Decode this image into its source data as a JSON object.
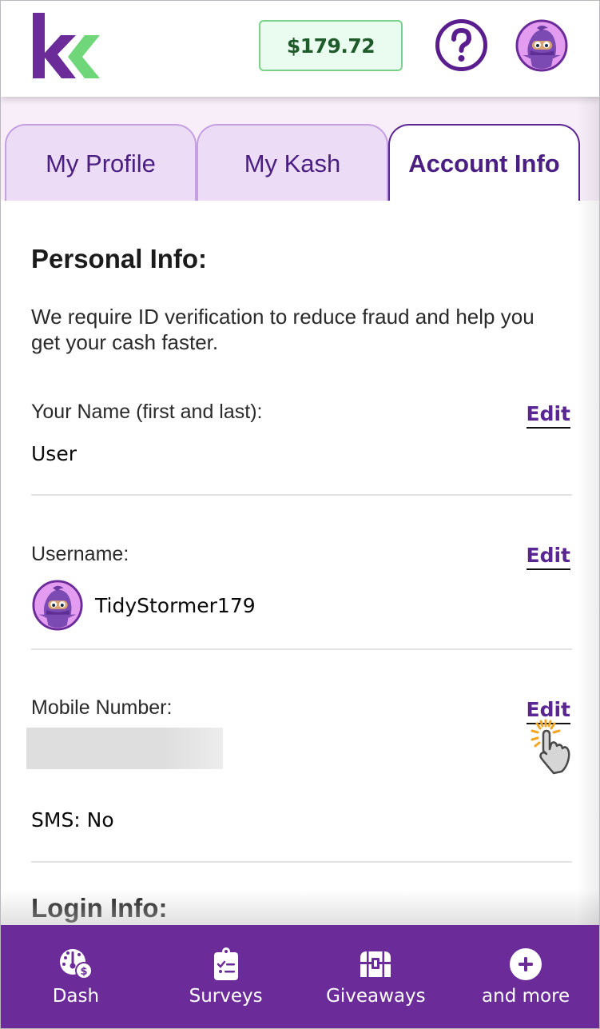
{
  "header": {
    "logo_alt": "Kashkick logo",
    "balance": "$179.72",
    "help_icon": "question-circle-icon",
    "avatar_icon": "ninja-avatar-icon"
  },
  "tabs": [
    {
      "label": "My Profile",
      "active": false
    },
    {
      "label": "My Kash",
      "active": false
    },
    {
      "label": "Account Info",
      "active": true
    }
  ],
  "personal_info": {
    "title": "Personal Info:",
    "intro": "We require ID verification to reduce fraud and help you get your cash faster.",
    "fields": [
      {
        "label": "Your Name (first and last):",
        "value": "User",
        "edit_label": "Edit"
      },
      {
        "label": "Username:",
        "value": "TidyStormer179",
        "edit_label": "Edit"
      },
      {
        "label": "Mobile Number:",
        "value": "",
        "edit_label": "Edit",
        "masked": true
      }
    ],
    "sms": "SMS: No"
  },
  "login_info": {
    "title": "Login Info:"
  },
  "bottom_nav": [
    {
      "label": "Dash",
      "icon": "dashboard-dollar-icon"
    },
    {
      "label": "Surveys",
      "icon": "clipboard-checklist-icon"
    },
    {
      "label": "Giveaways",
      "icon": "treasure-chest-icon"
    },
    {
      "label": "and more",
      "icon": "plus-circle-icon"
    }
  ],
  "colors": {
    "brand_purple": "#6b2c9a",
    "brand_green": "#6fd67a",
    "tab_inactive_bg": "#ecdcf6",
    "link": "#5a2693"
  }
}
